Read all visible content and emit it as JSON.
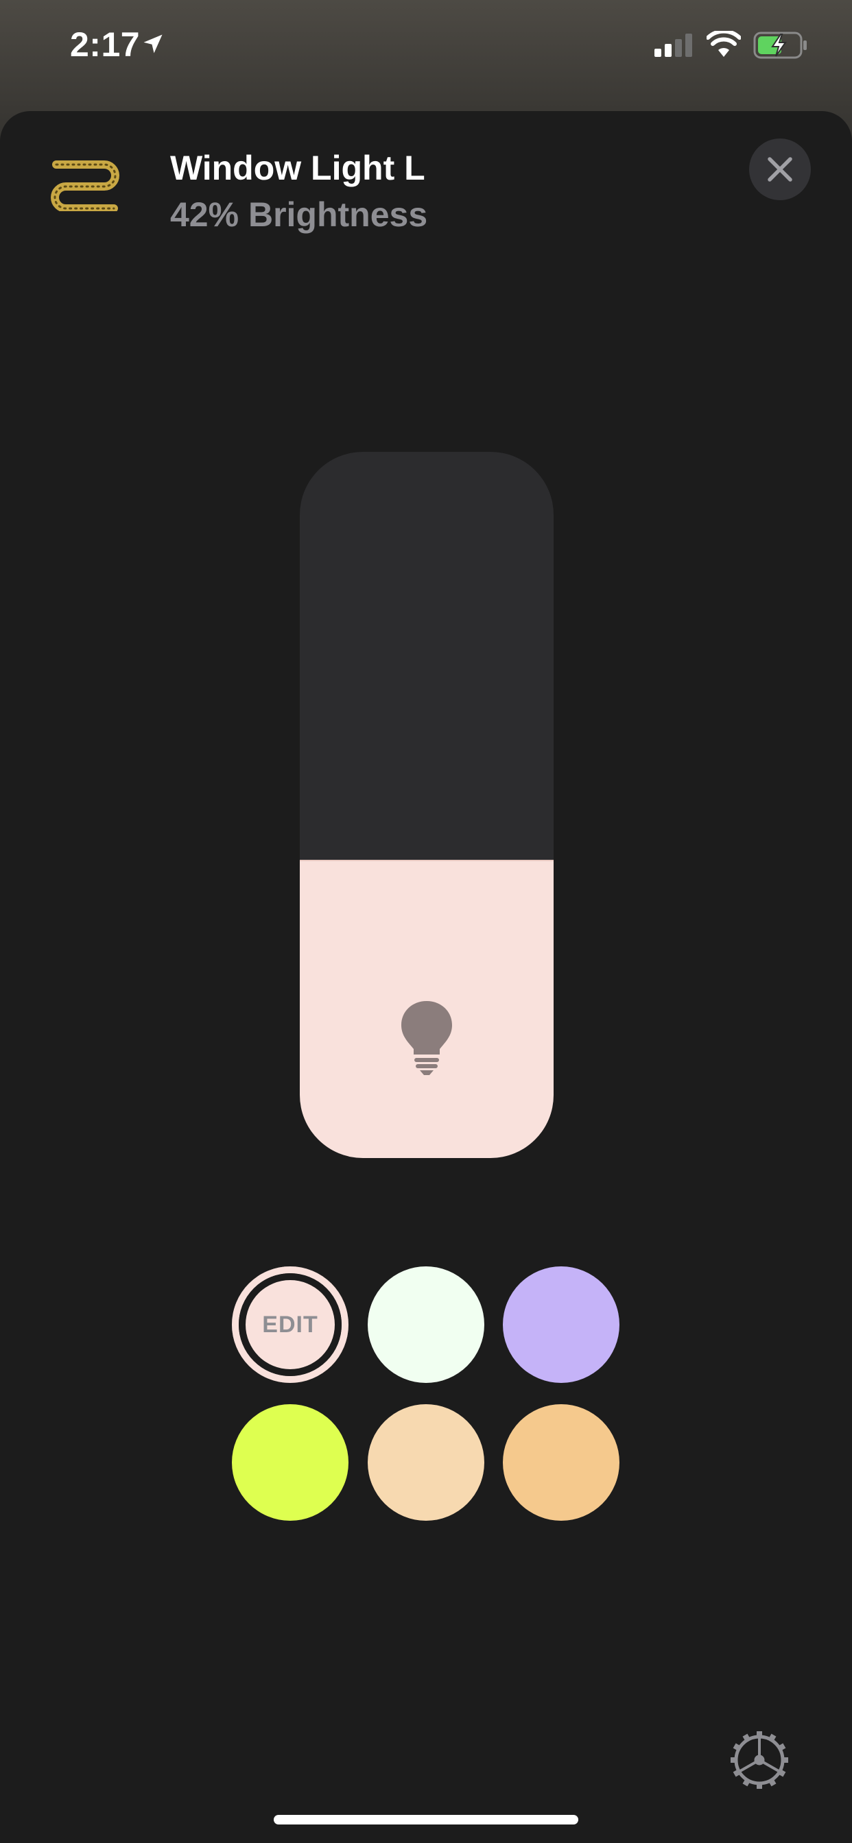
{
  "status_bar": {
    "time": "2:17",
    "icons": [
      "location-arrow-icon",
      "cellular-signal-icon",
      "wifi-icon",
      "battery-charging-icon"
    ]
  },
  "header": {
    "accessory_icon": "lightstrip-icon",
    "title": "Window Light L",
    "subtitle": "42% Brightness",
    "close_icon": "close-icon"
  },
  "brightness": {
    "level_percent": 42,
    "fill_color": "#f9e1dc",
    "track_color": "#2c2c2e",
    "icon": "lightbulb-icon"
  },
  "color_presets": {
    "edit_label": "EDIT",
    "swatches": [
      {
        "color": "#f9e1dc",
        "selected": true
      },
      {
        "color": "#f1fff1"
      },
      {
        "color": "#c5b3f8"
      },
      {
        "color": "#deff50"
      },
      {
        "color": "#f7d9b0"
      },
      {
        "color": "#f5c98d"
      }
    ]
  },
  "footer": {
    "settings_icon": "gear-icon"
  }
}
